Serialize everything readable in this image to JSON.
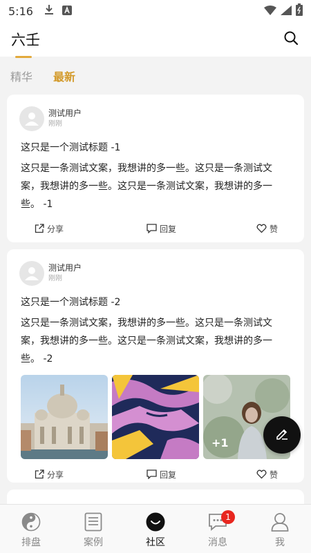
{
  "status_bar": {
    "time": "5:16"
  },
  "header": {
    "title": "六壬"
  },
  "tabs": [
    {
      "label": "精华",
      "active": false
    },
    {
      "label": "最新",
      "active": true
    }
  ],
  "posts": [
    {
      "user": "测试用户",
      "time": "刚刚",
      "title": "这只是一个测试标题 -1",
      "body": "这只是一条测试文案，我想讲的多一些。这只是一条测试文案，我想讲的多一些。这只是一条测试文案，我想讲的多一些。 -1",
      "actions": {
        "share": "分享",
        "reply": "回复",
        "like": "赞"
      }
    },
    {
      "user": "测试用户",
      "time": "刚刚",
      "title": "这只是一个测试标题 -2",
      "body": "这只是一条测试文案，我想讲的多一些。这只是一条测试文案，我想讲的多一些。这只是一条测试文案，我想讲的多一些。 -2",
      "image_more": "+1",
      "actions": {
        "share": "分享",
        "reply": "回复",
        "like": "赞"
      }
    }
  ],
  "bottom_nav": [
    {
      "label": "排盘",
      "icon": "yin-yang-icon"
    },
    {
      "label": "案例",
      "icon": "document-icon"
    },
    {
      "label": "社区",
      "icon": "community-icon",
      "active": true
    },
    {
      "label": "消息",
      "icon": "message-icon",
      "badge": "1"
    },
    {
      "label": "我",
      "icon": "user-icon"
    }
  ],
  "colors": {
    "accent": "#d39a2a",
    "badge": "#e8261f",
    "fab": "#111111"
  }
}
